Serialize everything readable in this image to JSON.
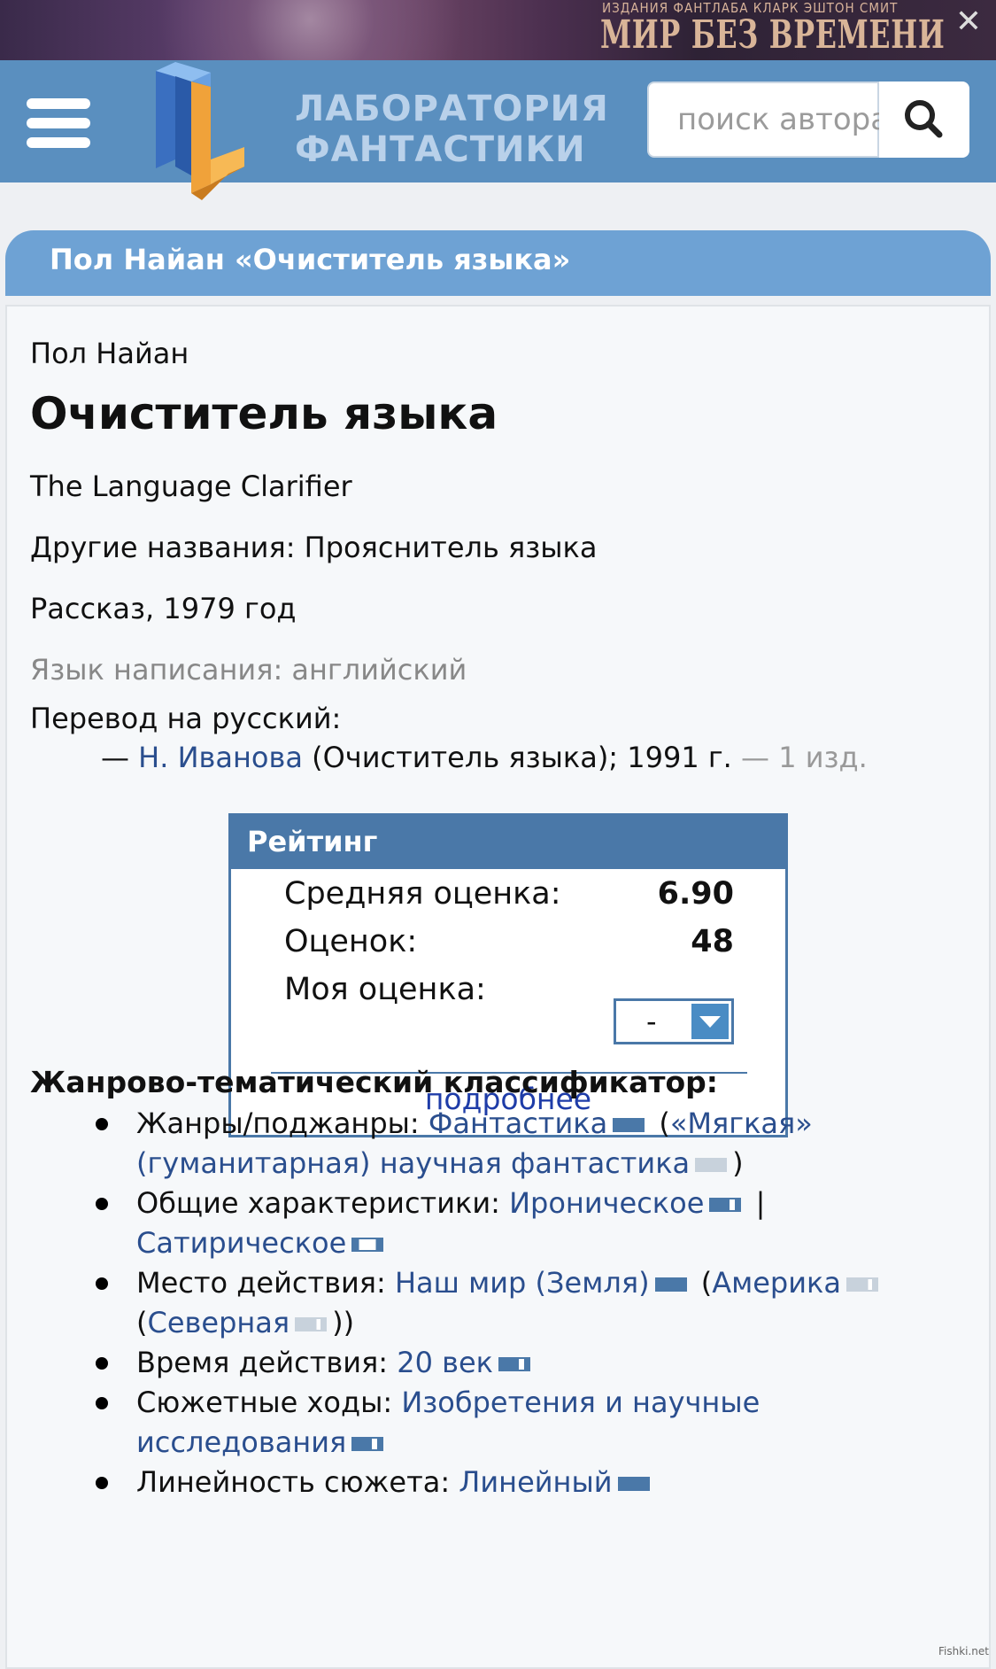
{
  "ad": {
    "top_line": "ИЗДАНИЯ ФАНТЛАБА  КЛАРК  ЭШТОН  СМИТ",
    "title": "МИР БЕЗ ВРЕМЕНИ",
    "close": "✕"
  },
  "header": {
    "brand_line1": "ЛАБОРАТОРИЯ",
    "brand_line2": "ФАНТАСТИКИ",
    "search_placeholder": "поиск автора",
    "colors": {
      "header_bg": "#5a8fbf",
      "accent": "#4a78a8"
    }
  },
  "page": {
    "heading": "Пол Найан «Очиститель языка»",
    "author": "Пол Найан",
    "title": "Очиститель языка",
    "original_title": "The Language Clarifier",
    "other_names": "Другие названия: Прояснитель языка",
    "type_year": "Рассказ, 1979 год",
    "language": "Язык написания: английский",
    "translation_header": "Перевод на русский:",
    "translation": {
      "dash": "— ",
      "translator": "Н. Иванова",
      "detail": " (Очиститель языка); 1991 г. ",
      "editions": "— 1 изд."
    }
  },
  "rating": {
    "header": "Рейтинг",
    "avg_label": "Средняя оценка:",
    "avg_value": "6.90",
    "count_label": "Оценок:",
    "count_value": "48",
    "my_label": "Моя оценка:",
    "my_value": "-",
    "more": "подробнее"
  },
  "classifier": {
    "header": "Жанрово-тематический классификатор:",
    "items": [
      {
        "label": "Жанры/поджанры: ",
        "l1": "Фантастика",
        "mid": " (",
        "l2": "«Мягкая» (гуманитарная) научная фантастика",
        "end": ")"
      },
      {
        "label": "Общие характеристики: ",
        "l1": "Ироническое",
        "mid": " | ",
        "l2": "Сатирическое"
      },
      {
        "label": "Место действия: ",
        "l1": "Наш мир (Земля)",
        "mid": " (",
        "l2": "Америка",
        "mid2": " (",
        "l3": "Северная",
        "end": "))"
      },
      {
        "label": "Время действия: ",
        "l1": "20 век"
      },
      {
        "label": "Сюжетные ходы: ",
        "l1": "Изобретения и научные исследования"
      },
      {
        "label": "Линейность сюжета: ",
        "l1": "Линейный"
      }
    ]
  },
  "watermark": "Fishki.net"
}
